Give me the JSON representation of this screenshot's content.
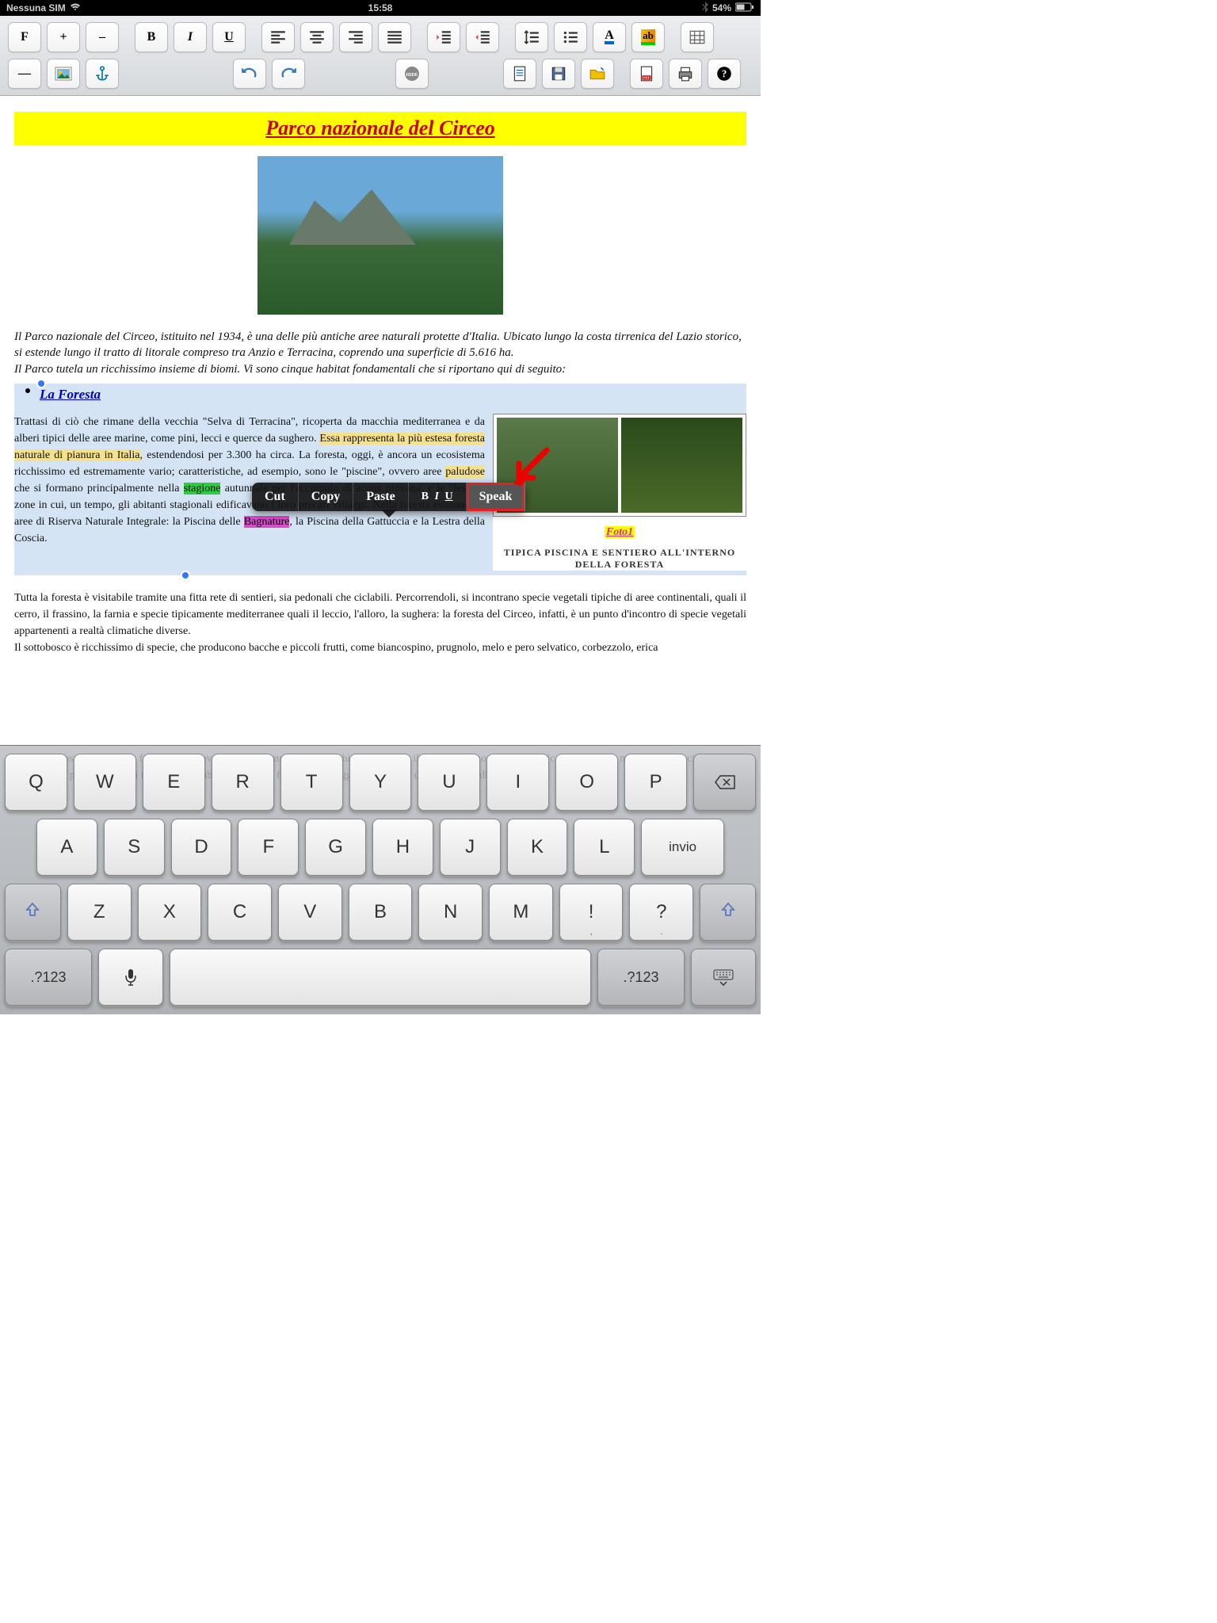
{
  "status": {
    "carrier": "Nessuna SIM",
    "time": "15:58",
    "battery": "54%"
  },
  "toolbar": {
    "font": "F",
    "inc": "+",
    "dec": "–",
    "bold": "B",
    "italic": "I",
    "underline": "U",
    "hr": "—"
  },
  "doc": {
    "title": "Parco nazionale del Circeo",
    "intro": "Il Parco nazionale del Circeo, istituito nel 1934, è una delle più antiche aree naturali protette d'Italia. Ubicato lungo la costa tirrenica del Lazio storico, si estende lungo il tratto di litorale compreso tra Anzio e Terracina, coprendo una superficie di 5.616 ha.",
    "intro2": "Il Parco tutela un ricchissimo insieme di biomi. Vi sono cinque habitat fondamentali che si riportano qui di seguito:",
    "foresta_h": "La Foresta",
    "foresta_p1a": "Trattasi di ciò che rimane della vecchia \"Selva di Terracina\", ricoperta da macchia mediterranea e da alberi tipici delle aree marine, come pini, lecci e querce da sughero. ",
    "foresta_hl1": "Essa rappresenta la più estesa foresta naturale di pianura in Italia",
    "foresta_p1b": ", estendendosi per 3.300 ha circa. La foresta, oggi, è ancora un ecosistema ricchissimo ed estremamente vario; caratteristiche, ad esempio, sono le \"piscine\", ovvero aree ",
    "foresta_hl2": "paludose",
    "foresta_p1c": " che si formano principalmente nella ",
    "foresta_hl3": "stagione",
    "foresta_p1d": " autunnale per l'accumulo di acqua piovana, e le \"lestre\", zone in cui, un tempo, gli abitanti stagionali edificavano i loro precari villaggi. Nella foresta esistono tre aree di Riserva Naturale Integrale: la Piscina delle ",
    "foresta_hl4": "Bagnature",
    "foresta_p1e": ", la Piscina della Gattuccia e la Lestra della Coscia.",
    "foto_label": "Foto1",
    "caption": "tipica piscina e sentiero all'interno della foresta",
    "para2": "Tutta la foresta è visitabile tramite una fitta rete di sentieri, sia pedonali che ciclabili. Percorrendoli, si incontrano specie vegetali tipiche di aree continentali, quali il cerro, il frassino, la farnia e specie tipicamente mediterranee quali il leccio, l'alloro, la sughera: la foresta del Circeo, infatti, è un punto d'incontro di specie vegetali appartenenti a realtà climatiche diverse.",
    "para3": "Il sottobosco è ricchissimo di specie, che producono bacche e piccoli frutti, come biancospino, prugnolo, melo e pero selvatico, corbezzolo, erica"
  },
  "ctx": {
    "cut": "Cut",
    "copy": "Copy",
    "paste": "Paste",
    "speak": "Speak"
  },
  "kbd": {
    "r1": [
      "Q",
      "W",
      "E",
      "R",
      "T",
      "Y",
      "U",
      "I",
      "O",
      "P"
    ],
    "r2": [
      "A",
      "S",
      "D",
      "F",
      "G",
      "H",
      "J",
      "K",
      "L"
    ],
    "r3": [
      "Z",
      "X",
      "C",
      "V",
      "B",
      "N",
      "M"
    ],
    "invio": "invio",
    "num": ".?123",
    "punct1": "!",
    "punct1b": ",",
    "punct2": "?",
    "punct2b": "."
  },
  "faded": "La foresta ospita una ricca fauna: vi si trovano, tra i mammiferi, il cinghiale, la volpe, il tasso, il daino, la lepre, il riccio, l'istrice e molte altre specie di piccoli roditori e di pipistrelli. Tra i rettili e gli anfibi vivono nella foresta la testuggine comune e diverse specie di serpenti."
}
